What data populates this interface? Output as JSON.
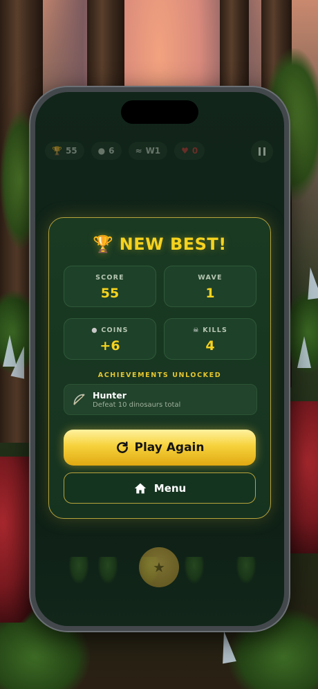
{
  "hud": {
    "score": "55",
    "coins": "6",
    "wave": "W1",
    "lives": "0",
    "icons": [
      "trophy-icon",
      "coin-icon",
      "wave-icon",
      "heart-icon",
      "pause-icon"
    ]
  },
  "modal": {
    "title": "NEW BEST!",
    "stats": [
      {
        "label": "SCORE",
        "value": "55"
      },
      {
        "label": "WAVE",
        "value": "1"
      },
      {
        "label": "COINS",
        "value": "+6"
      },
      {
        "label": "KILLS",
        "value": "4"
      }
    ],
    "achievements_heading": "ACHIEVEMENTS UNLOCKED",
    "achievement": {
      "name": "Hunter",
      "description": "Defeat 10 dinosaurs total",
      "icon": "bow-icon"
    },
    "play_again_label": "Play Again",
    "menu_label": "Menu"
  },
  "colors": {
    "accent": "#f7d31e",
    "panel": "#1a3a22",
    "border": "#b9a43c"
  }
}
